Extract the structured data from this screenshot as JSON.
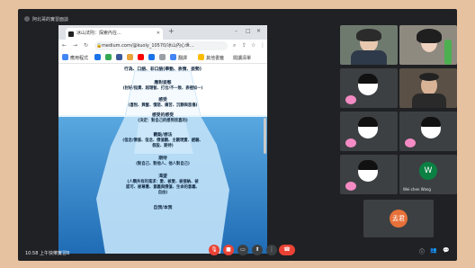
{
  "meeting": {
    "title": "阿北哥的實習面談",
    "time": "10:58 上午",
    "name": "快樂實習B"
  },
  "browser": {
    "tab_title": "冰山法則：探索內在...",
    "url": "medium.com/@kuoly_10570/冰山內心世...",
    "bookmarks": [
      "應用程式",
      "",
      "",
      "",
      "",
      "",
      "",
      "翻譯",
      "",
      "其他書籤",
      "閱讀清單"
    ]
  },
  "iceberg": {
    "lines": [
      {
        "text": "行為、口語、非口語(舉動、表情、姿勢)",
        "head": true
      },
      {
        "text": "應對姿態",
        "head": true
      },
      {
        "text": "(討好/指責、超理智、打岔/不一致、表裡如一)",
        "head": false
      },
      {
        "text": "感受",
        "head": true
      },
      {
        "text": "(喜悅、興奮、憤怒、痛苦、沉靜與悲傷)",
        "head": false
      },
      {
        "text": "感受的感受",
        "head": true
      },
      {
        "text": "(決定：對自己的感到欣喜的)",
        "head": false
      },
      {
        "text": "觀點/想法",
        "head": true
      },
      {
        "text": "(信念/價值、信念、價值觀、主觀現實、經驗、",
        "head": false
      },
      {
        "text": "假設、期待)",
        "head": false
      },
      {
        "text": "期待",
        "head": true
      },
      {
        "text": "(對自己、對他人、他人對自己)",
        "head": false
      },
      {
        "text": "渴望",
        "head": true
      },
      {
        "text": "(人類共有的渴求：愛、被愛、被接納、被",
        "head": false
      },
      {
        "text": "認可、被尊重、意義與價值、生命的意義、",
        "head": false
      },
      {
        "text": "自由)",
        "head": false
      },
      {
        "text": "自我/本我",
        "head": true
      }
    ]
  },
  "participants": {
    "w_initial": "W",
    "w_name": "Wei-chen Wang",
    "red_avatar": "孟君"
  },
  "colors": {
    "meet_bg": "#202124",
    "accent_red": "#ea4335",
    "avatar_green": "#0b8043",
    "avatar_orange": "#e8713a"
  },
  "controls": {
    "mic": "mic-off-icon",
    "cam": "camera-off-icon",
    "cc": "captions-icon",
    "present": "present-icon",
    "more": "more-icon",
    "end": "end-call-icon"
  }
}
